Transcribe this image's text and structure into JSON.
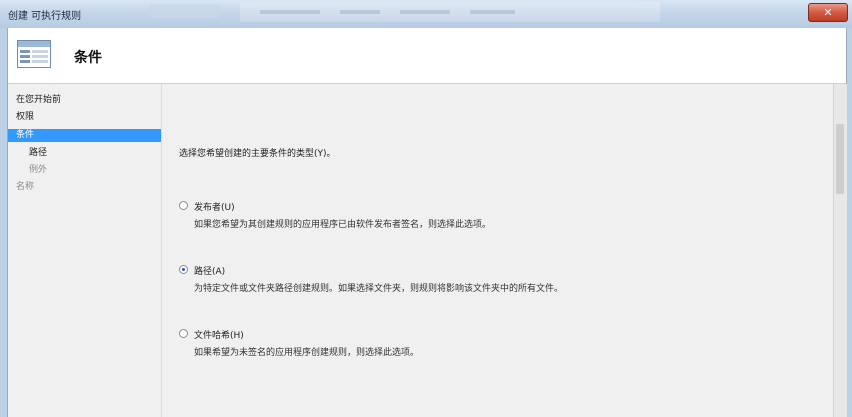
{
  "window": {
    "title": "创建 可执行规则",
    "close_label": "✕"
  },
  "header": {
    "title": "条件"
  },
  "nav": {
    "items": [
      {
        "label": "在您开始前",
        "state": "normal"
      },
      {
        "label": "权限",
        "state": "normal"
      },
      {
        "label": "条件",
        "state": "selected"
      },
      {
        "label": "路径",
        "state": "sub"
      },
      {
        "label": "例外",
        "state": "sub-dim"
      },
      {
        "label": "名称",
        "state": "dim"
      }
    ]
  },
  "main": {
    "prompt": "选择您希望创建的主要条件的类型(Y)。",
    "options": [
      {
        "label": "发布者(U)",
        "description": "如果您希望为其创建规则的应用程序已由软件发布者签名，则选择此选项。",
        "checked": false
      },
      {
        "label": "路径(A)",
        "description": "为特定文件或文件夹路径创建规则。如果选择文件夹，则规则将影响该文件夹中的所有文件。",
        "checked": true
      },
      {
        "label": "文件哈希(H)",
        "description": "如果希望为未签名的应用程序创建规则，则选择此选项。",
        "checked": false
      }
    ]
  },
  "colors": {
    "selection": "#3399ff",
    "close_button": "#c03b24"
  }
}
